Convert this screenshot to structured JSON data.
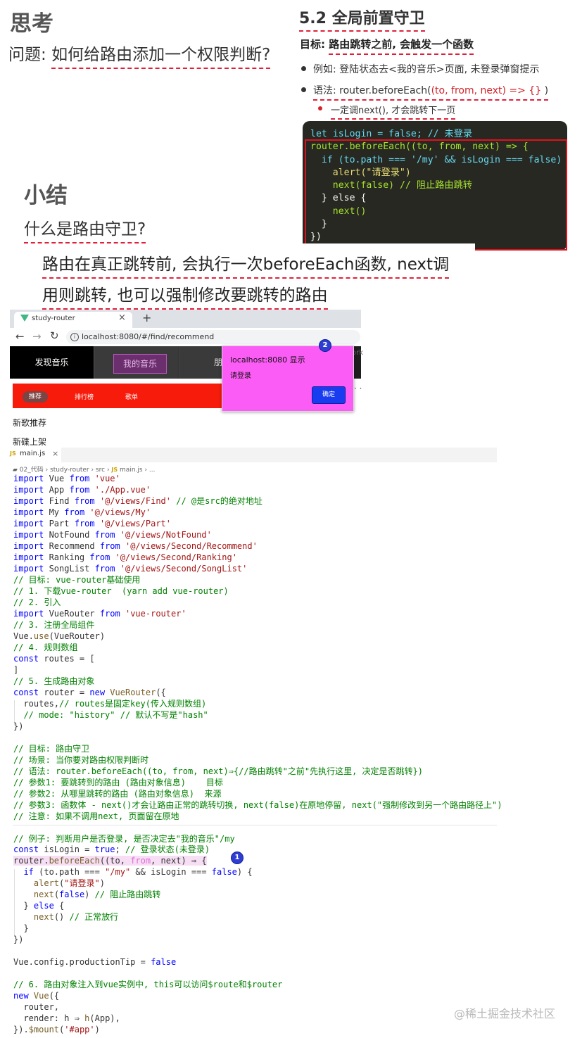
{
  "slide_think": {
    "title": "思考",
    "question_prefix": "问题: ",
    "question_highlight": "如何给路由添加一个权限判断?"
  },
  "slide_guard": {
    "title": "5.2 全局前置守卫",
    "goal_prefix": "目标: ",
    "goal_highlight": "路由跳转之前, 会触发一个函数",
    "bullet_1": "例如: 登陆状态去<我的音乐>页面, 未登录弹窗提示",
    "bullet_2_prefix": "语法: router.beforeEach(",
    "bullet_2_red": "(to, from, next) =>  {}",
    "bullet_2_suffix": " )",
    "bullet_3": "一定调next(), 才会跳转下一页",
    "code_lines": [
      "let isLogin = false; // 未登录",
      "router.beforeEach((to, from, next) => {",
      "  if (to.path === '/my' && isLogin === false) {",
      "    alert(\"请登录\")",
      "    next(false) // 阻止路由跳转",
      "  } else {",
      "    next()",
      "  }",
      "})"
    ]
  },
  "summary": {
    "title": "小结",
    "question": "什么是路由守卫?",
    "answer_line_1": "路由在真正跳转前, 会执行一次beforeEach函数, next调",
    "answer_line_2": "用则跳转, 也可以强制修改要跳转的路由"
  },
  "browser": {
    "tab_title": "study-router",
    "tab_close": "×",
    "new_tab": "+",
    "url": "localhost:8080/#/find/recommend",
    "nav": {
      "find": "发现音乐",
      "my": "我的音乐",
      "part": "朋"
    },
    "sub_nav": {
      "recommend": "推荐",
      "ranking": "排行榜",
      "songlist": "歌单"
    },
    "blurred_right": "ork",
    "dots": "· ·",
    "new_songs": "新歌推荐",
    "new_albums": "新碟上架",
    "alert": {
      "title": "localhost:8080 显示",
      "message": "请登录",
      "ok": "确定"
    },
    "badge_2": "2"
  },
  "editor": {
    "tab_js": "JS",
    "tab_name": "main.js",
    "tab_close": "×",
    "breadcrumb": [
      "02_代码",
      "study-router",
      "src",
      "main.js",
      "..."
    ],
    "badge_1": "1"
  },
  "watermark": "@稀土掘金技术社区",
  "colors": {
    "accent_red": "#e0203a",
    "alert_bg": "#fb5cf5",
    "alert_button": "#1a3cf0",
    "sub_nav_red": "#f61b0b",
    "code_dark_bg": "#272822"
  }
}
